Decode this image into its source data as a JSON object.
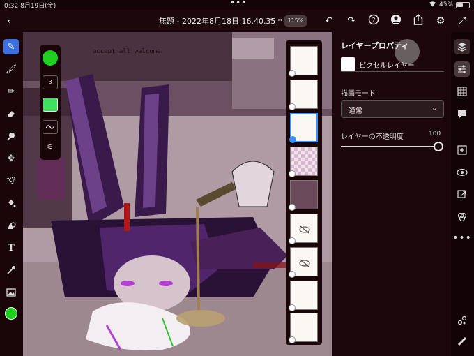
{
  "status_bar": {
    "time": "0:32",
    "date": "8月19日(金)",
    "dots": "•••",
    "battery": "45%",
    "battery_level": 0.45
  },
  "top_bar": {
    "back_icon": "chevron-left-icon",
    "document_title": "無題 - 2022年8月18日 16.40.35 *",
    "title_dropdown_icon": "chevron-down-icon",
    "zoom": "115%",
    "actions": [
      "undo-icon",
      "redo-icon",
      "help-icon",
      "account-icon",
      "share-icon",
      "gear-icon",
      "fullscreen-icon"
    ]
  },
  "left_toolbar": {
    "tools": [
      "brush-icon",
      "paintbrush-icon",
      "pencil-icon",
      "eraser-icon",
      "smudge-icon",
      "move-icon",
      "lasso-icon",
      "fill-icon",
      "shape-icon",
      "text-icon",
      "eyedropper-icon",
      "image-icon"
    ],
    "active_tool": "brush-icon",
    "current_color": "#20d020"
  },
  "brush_panel": {
    "size": "3",
    "color": "#40e060"
  },
  "canvas": {
    "wall_text": "accept all welcome"
  },
  "layers": [
    {
      "name": "layer-1",
      "visible": true,
      "selected": false
    },
    {
      "name": "layer-2",
      "visible": true,
      "selected": false
    },
    {
      "name": "layer-3",
      "visible": true,
      "selected": true
    },
    {
      "name": "layer-4",
      "visible": true,
      "selected": false
    },
    {
      "name": "layer-5",
      "visible": true,
      "selected": false
    },
    {
      "name": "layer-6",
      "visible": false,
      "selected": false
    },
    {
      "name": "layer-7",
      "visible": false,
      "selected": false
    },
    {
      "name": "layer-8",
      "visible": true,
      "selected": false
    },
    {
      "name": "layer-9",
      "visible": true,
      "selected": false
    }
  ],
  "properties": {
    "title": "レイヤープロパティ",
    "layer_name": "ピクセルレイヤー",
    "blend_mode_label": "描画モード",
    "blend_mode_value": "通常",
    "opacity_label": "レイヤーの不透明度",
    "opacity_value": "100"
  },
  "right_bar": {
    "icons": [
      "layers-icon",
      "sliders-icon",
      "grid-icon",
      "comment-icon",
      "add-layer-icon",
      "eye-icon",
      "export-icon",
      "blend-icon",
      "more-icon"
    ],
    "bottom_icons": [
      "settings-nodes-icon",
      "ruler-icon"
    ],
    "active": "sliders-icon"
  }
}
